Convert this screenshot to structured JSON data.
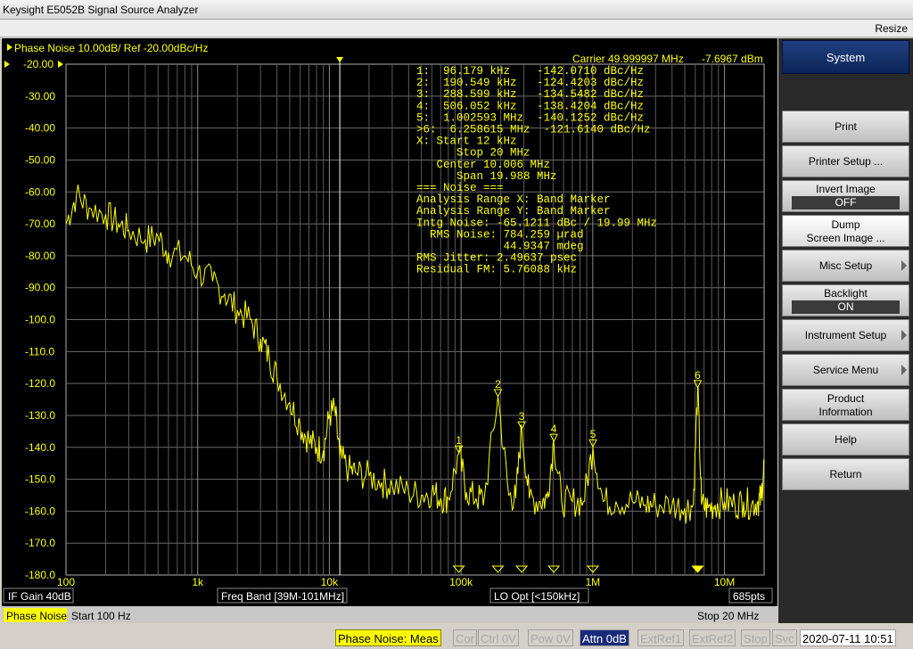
{
  "window": {
    "title": "Keysight E5052B Signal Source Analyzer",
    "resize_label": "Resize"
  },
  "trace": {
    "header": "Phase Noise 10.00dB/ Ref -20.00dBc/Hz",
    "carrier": "Carrier 49.999997 MHz",
    "carrier_power": "-7.6967 dBm",
    "ref_marker": "-20.00",
    "bottom_info": {
      "if_gain": "IF Gain 40dB",
      "freq_band": "Freq Band [39M-101MHz]",
      "lo_opt": "LO Opt [<150kHz]",
      "points": "685pts"
    },
    "footer": {
      "meas": "Phase Noise",
      "start": "Start 100 Hz",
      "stop": "Stop 20 MHz"
    }
  },
  "chart_data": {
    "type": "line",
    "xscale": "log",
    "xlim": [
      100,
      20000000
    ],
    "ylim": [
      -180,
      -20
    ],
    "yticks": [
      "-20.00",
      "-30.00",
      "-40.00",
      "-50.00",
      "-60.00",
      "-70.00",
      "-80.00",
      "-90.00",
      "-100.0",
      "-110.0",
      "-120.0",
      "-130.0",
      "-140.0",
      "-150.0",
      "-160.0",
      "-170.0",
      "-180.0"
    ],
    "xtick_labels": [
      {
        "x": 100,
        "label": "100"
      },
      {
        "x": 1000,
        "label": "1k"
      },
      {
        "x": 10000,
        "label": "10k"
      },
      {
        "x": 100000,
        "label": "100k"
      },
      {
        "x": 1000000,
        "label": "1M"
      },
      {
        "x": 10000000,
        "label": "10M"
      }
    ],
    "band_marker_start_hz": 12000,
    "series": [
      {
        "color": "#ffff00",
        "x": [
          100,
          120,
          150,
          200,
          250,
          300,
          400,
          500,
          600,
          800,
          1000,
          1300,
          1600,
          2000,
          2500,
          3000,
          3500,
          4000,
          5000,
          6000,
          7000,
          8000,
          9000,
          10000,
          11000,
          12000,
          14000,
          16000,
          20000,
          25000,
          30000,
          40000,
          50000,
          60000,
          70000,
          80000,
          96179,
          110000,
          130000,
          150000,
          190549,
          230000,
          260000,
          288599,
          330000,
          400000,
          450000,
          506052,
          580000,
          700000,
          850000,
          1002593,
          1200000,
          1500000,
          2000000,
          2500000,
          3000000,
          4000000,
          5000000,
          5800000,
          6258615,
          6700000,
          7500000,
          8500000,
          10000000,
          12000000,
          14000000,
          16000000,
          18000000,
          19000000,
          20000000
        ],
        "y": [
          -70,
          -61,
          -65,
          -67,
          -70,
          -72,
          -75,
          -74,
          -79,
          -80,
          -85,
          -88,
          -92,
          -97,
          -100,
          -106,
          -112,
          -118,
          -126,
          -133,
          -138,
          -140,
          -141,
          -130,
          -128,
          -143,
          -147,
          -148,
          -149,
          -151,
          -152,
          -154,
          -155,
          -154,
          -156,
          -156,
          -142,
          -154,
          -156,
          -156,
          -124,
          -155,
          -156,
          -134,
          -156,
          -157,
          -156,
          -138,
          -157,
          -157,
          -157,
          -140,
          -157,
          -157,
          -157,
          -158,
          -158,
          -158,
          -159,
          -158,
          -121,
          -158,
          -159,
          -158,
          -157,
          -158,
          -157,
          -158,
          -157,
          -156,
          -145
        ]
      }
    ],
    "markers": [
      {
        "id": "1",
        "x": 96179,
        "y": -142.071
      },
      {
        "id": "2",
        "x": 190549,
        "y": -124.4203
      },
      {
        "id": "3",
        "x": 288599,
        "y": -134.5482
      },
      {
        "id": "4",
        "x": 506052,
        "y": -138.4204
      },
      {
        "id": "5",
        "x": 1002593,
        "y": -140.1252
      },
      {
        "id": "6",
        "x": 6258615,
        "y": -121.614
      }
    ]
  },
  "readout_lines": [
    "1:  96.179 kHz    -142.0710 dBc/Hz",
    "2:  190.549 kHz   -124.4203 dBc/Hz",
    "3:  288.599 kHz   -134.5482 dBc/Hz",
    "4:  506.052 kHz   -138.4204 dBc/Hz",
    "5:  1.002593 MHz  -140.1252 dBc/Hz",
    ">6:  6.258615 MHz  -121.6140 dBc/Hz",
    "X: Start 12 kHz",
    "      Stop 20 MHz",
    "   Center 10.006 MHz",
    "      Span 19.988 MHz",
    "=== Noise ===",
    "Analysis Range X: Band Marker",
    "Analysis Range Y: Band Marker",
    "Intg Noise: -65.1211 dBc / 19.99 MHz",
    "  RMS Noise: 784.259 µrad",
    "             44.9347 mdeg",
    "RMS Jitter: 2.49637 psec",
    "Residual FM: 5.76088 kHz"
  ],
  "softkeys": {
    "system": "System",
    "print": "Print",
    "printer_setup": "Printer Setup ...",
    "invert_image": "Invert Image",
    "invert_image_value": "OFF",
    "dump_line1": "Dump",
    "dump_line2": "Screen Image ...",
    "misc_setup": "Misc Setup",
    "backlight": "Backlight",
    "backlight_value": "ON",
    "instrument_setup": "Instrument Setup",
    "service_menu": "Service Menu",
    "product_line1": "Product",
    "product_line2": "Information",
    "help": "Help",
    "return": "Return"
  },
  "status": {
    "meas": "Phase Noise: Meas",
    "cor": "Cor",
    "ctrl": "Ctrl  0V",
    "pow": "Pow  0V",
    "attn": "Attn 0dB",
    "extref1": "ExtRef1",
    "extref2": "ExtRef2",
    "stop": "Stop",
    "svc": "Svc",
    "datetime": "2020-07-11 10:51"
  }
}
